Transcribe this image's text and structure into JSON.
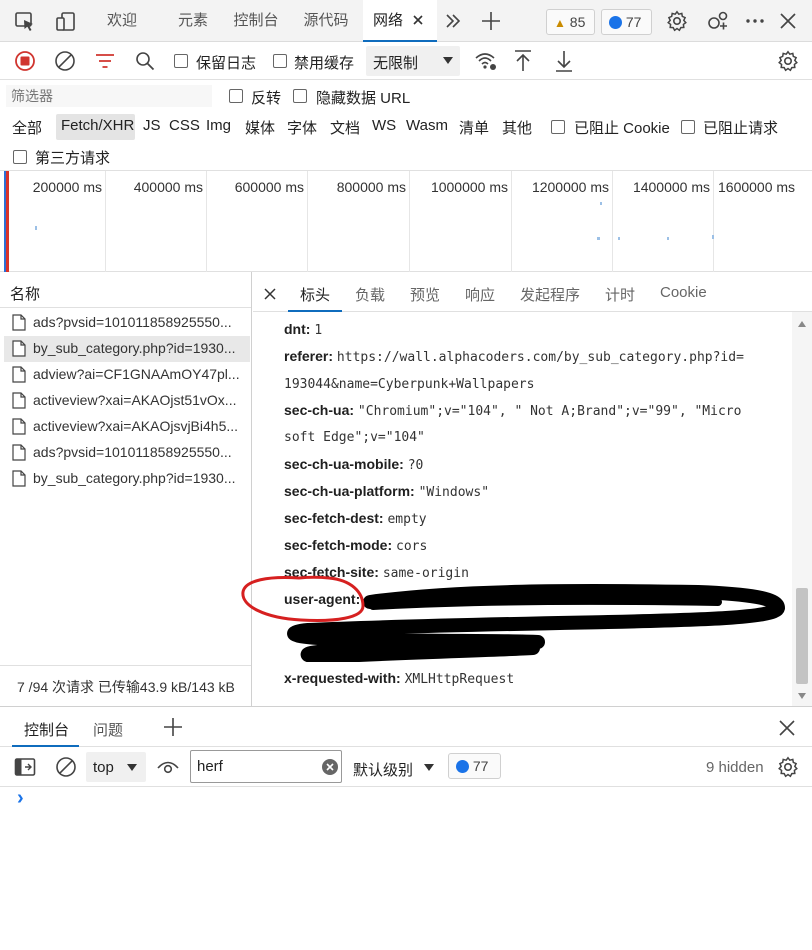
{
  "topbar": {
    "tabs": [
      "欢迎",
      "元素",
      "控制台",
      "源代码",
      "网络"
    ],
    "active_tab": "网络",
    "warnings": "85",
    "messages": "77",
    "icons": [
      "inspect-icon",
      "device-emulation-icon",
      "close-tab-icon",
      "more-tabs-icon",
      "add-tab-icon",
      "settings-icon",
      "customize-icon",
      "more-icon",
      "close-devtools-icon"
    ]
  },
  "toolbar": {
    "preserve_log": "保留日志",
    "disable_cache": "禁用缓存",
    "throttling": "无限制"
  },
  "filter": {
    "placeholder": "筛选器",
    "invert": "反转",
    "hide_data_urls": "隐藏数据 URL"
  },
  "types": {
    "items": [
      "全部",
      "Fetch/XHR",
      "JS",
      "CSS",
      "Img",
      "媒体",
      "字体",
      "文档",
      "WS",
      "Wasm",
      "清单",
      "其他"
    ],
    "active": "Fetch/XHR",
    "blocked_cookies": "已阻止 Cookie",
    "blocked_requests": "已阻止请求",
    "third_party": "第三方请求"
  },
  "timeline": {
    "ticks": [
      "200000 ms",
      "400000 ms",
      "600000 ms",
      "800000 ms",
      "1000000 ms",
      "1200000 ms",
      "1400000 ms",
      "1600000 ms"
    ]
  },
  "requests": {
    "header": "名称",
    "rows": [
      "ads?pvsid=101011858925550...",
      "by_sub_category.php?id=1930...",
      "adview?ai=CF1GNAAmOY47pl...",
      "activeview?xai=AKAOjst51vOx...",
      "activeview?xai=AKAOjsvjBi4h5...",
      "ads?pvsid=101011858925550...",
      "by_sub_category.php?id=1930..."
    ],
    "selected_index": 1,
    "status": "7 /94 次请求  已传输43.9 kB/143 kB"
  },
  "detail": {
    "tabs": [
      "标头",
      "负载",
      "预览",
      "响应",
      "发起程序",
      "计时",
      "Cookie"
    ],
    "active_tab": "标头",
    "headers": [
      {
        "key": "dnt:",
        "value": "1"
      },
      {
        "key": "referer:",
        "value": "https://wall.alphacoders.com/by_sub_category.php?id=",
        "value2": "193044&name=Cyberpunk+Wallpapers"
      },
      {
        "key": "sec-ch-ua:",
        "value": "\"Chromium\";v=\"104\", \" Not A;Brand\";v=\"99\", \"Micro",
        "value2": "soft Edge\";v=\"104\""
      },
      {
        "key": "sec-ch-ua-mobile:",
        "value": "?0"
      },
      {
        "key": "sec-ch-ua-platform:",
        "value": "\"Windows\""
      },
      {
        "key": "sec-fetch-dest:",
        "value": "empty"
      },
      {
        "key": "sec-fetch-mode:",
        "value": "cors"
      },
      {
        "key": "sec-fetch-site:",
        "value": "same-origin"
      },
      {
        "key": "user-agent:",
        "value": ""
      },
      {
        "key": "x-requested-with:",
        "value": "XMLHttpRequest"
      }
    ]
  },
  "drawer": {
    "tabs": [
      "控制台",
      "问题"
    ],
    "active_tab": "控制台",
    "context": "top",
    "filter_value": "herf",
    "level": "默认级别",
    "messages": "77",
    "hidden": "9 hidden",
    "prompt": "›"
  },
  "colors": {
    "accent": "#0f6cbd",
    "record_red": "#d0352f",
    "annotation_red": "#d62020",
    "redaction_black": "#000000"
  }
}
